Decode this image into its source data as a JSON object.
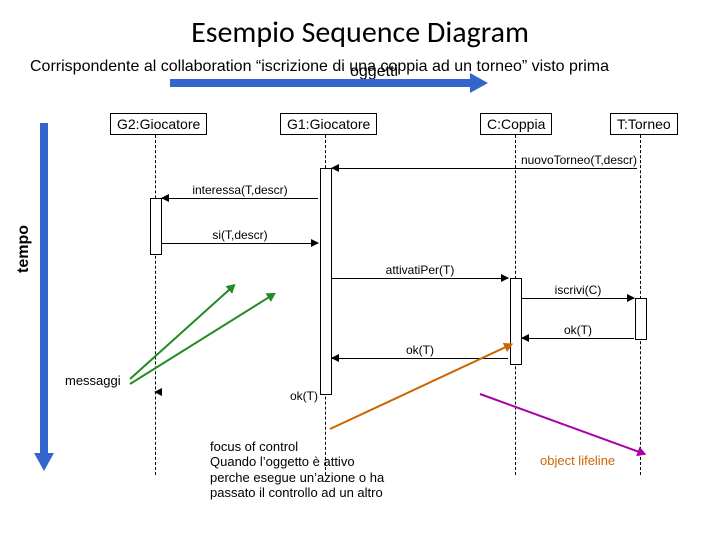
{
  "title": "Esempio Sequence Diagram",
  "subtitle": "Corrispondente al collaboration “iscrizione di una coppia ad un torneo” visto prima",
  "axis": {
    "time": "tempo",
    "objects": "oggetti"
  },
  "objects": {
    "g2": "G2:Giocatore",
    "g1": "G1:Giocatore",
    "c": "C:Coppia",
    "t": "T:Torneo"
  },
  "messages": {
    "nuovoTorneo": "nuovoTorneo(T,descr)",
    "interessa": "interessa(T,descr)",
    "si": "si(T,descr)",
    "attivatiPer": "attivatiPer(T)",
    "iscrivi": "iscrivi(C)",
    "okCT": "ok(T)",
    "okG1C": "ok(T)",
    "okG2G1": "ok(T)"
  },
  "annotations": {
    "messaggi": "messaggi",
    "focus": "focus of control\nQuando l’oggetto è attivo\nperche esegue un’azione o ha\npassato il controllo ad un altro",
    "lifeline": "object lifeline"
  },
  "chart_data": {
    "type": "sequence-diagram",
    "participants": [
      "G2:Giocatore",
      "G1:Giocatore",
      "C:Coppia",
      "T:Torneo"
    ],
    "messages": [
      {
        "from": "T:Torneo",
        "to": "G1:Giocatore",
        "label": "nuovoTorneo(T,descr)"
      },
      {
        "from": "G1:Giocatore",
        "to": "G2:Giocatore",
        "label": "interessa(T,descr)"
      },
      {
        "from": "G2:Giocatore",
        "to": "G1:Giocatore",
        "label": "si(T,descr)"
      },
      {
        "from": "G1:Giocatore",
        "to": "C:Coppia",
        "label": "attivatiPer(T)"
      },
      {
        "from": "C:Coppia",
        "to": "T:Torneo",
        "label": "iscrivi(C)"
      },
      {
        "from": "T:Torneo",
        "to": "C:Coppia",
        "label": "ok(T)"
      },
      {
        "from": "C:Coppia",
        "to": "G1:Giocatore",
        "label": "ok(T)"
      },
      {
        "from": "G1:Giocatore",
        "to": "G2:Giocatore",
        "label": "ok(T)"
      }
    ]
  }
}
